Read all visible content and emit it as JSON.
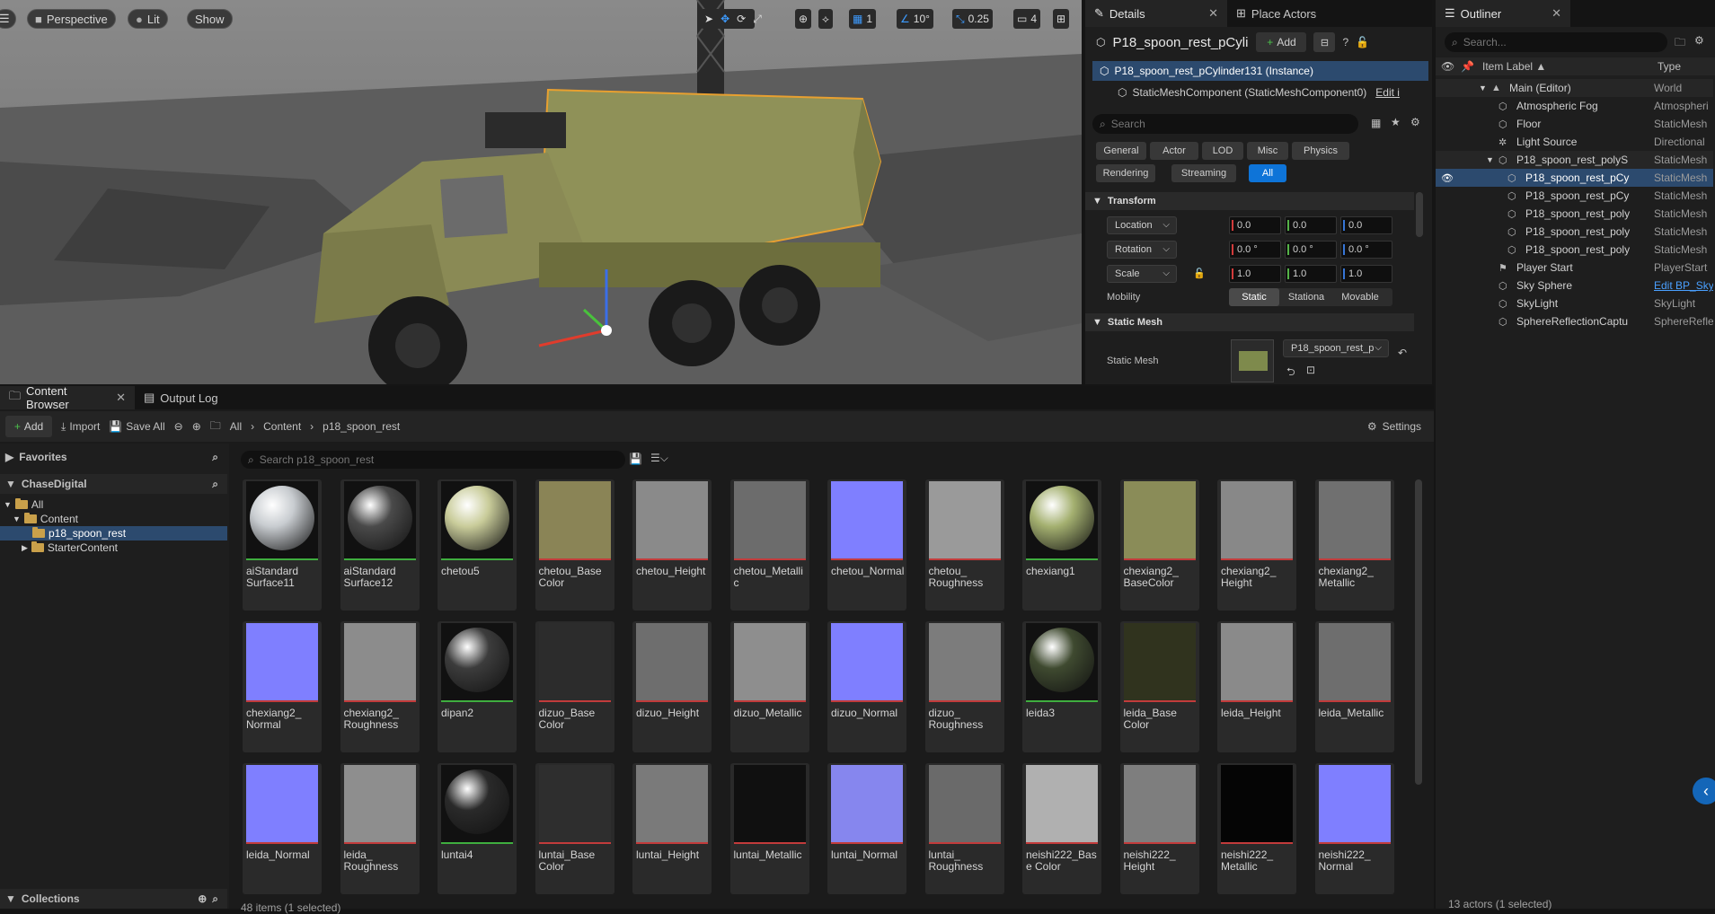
{
  "viewport": {
    "perspective": "Perspective",
    "lit": "Lit",
    "show": "Show",
    "grid_snap": "1",
    "rotate_snap": "10°",
    "scale_snap": "0.25",
    "camera_speed": "4"
  },
  "details": {
    "tab_label": "Details",
    "place_actors_tab": "Place Actors",
    "object_name": "P18_spoon_rest_pCylinde",
    "add_label": "Add",
    "instance_row": "P18_spoon_rest_pCylinder131 (Instance)",
    "component_row": "StaticMeshComponent (StaticMeshComponent0)",
    "edit_link": "Edit i",
    "search_placeholder": "Search",
    "filters": [
      "General",
      "Actor",
      "LOD",
      "Misc",
      "Physics",
      "Rendering",
      "Streaming",
      "All"
    ],
    "transform_header": "Transform",
    "location_label": "Location",
    "rotation_label": "Rotation",
    "scale_label": "Scale",
    "location": [
      "0.0",
      "0.0",
      "0.0"
    ],
    "rotation": [
      "0.0 °",
      "0.0 °",
      "0.0 °"
    ],
    "scale": [
      "1.0",
      "1.0",
      "1.0"
    ],
    "mobility_label": "Mobility",
    "mobility_options": [
      "Static",
      "Stationa",
      "Movable"
    ],
    "static_mesh_header": "Static Mesh",
    "static_mesh_label": "Static Mesh",
    "static_mesh_value": "P18_spoon_rest_p"
  },
  "outliner": {
    "tab_label": "Outliner",
    "search_placeholder": "Search...",
    "col_label": "Item Label ▲",
    "col_type": "Type",
    "rows": [
      {
        "label": "Main (Editor)",
        "type": "World"
      },
      {
        "label": "Atmospheric Fog",
        "type": "Atmospheri"
      },
      {
        "label": "Floor",
        "type": "StaticMesh"
      },
      {
        "label": "Light Source",
        "type": "Directional"
      },
      {
        "label": "P18_spoon_rest_polyS",
        "type": "StaticMesh"
      },
      {
        "label": "P18_spoon_rest_pCy",
        "type": "StaticMesh"
      },
      {
        "label": "P18_spoon_rest_pCy",
        "type": "StaticMesh"
      },
      {
        "label": "P18_spoon_rest_poly",
        "type": "StaticMesh"
      },
      {
        "label": "P18_spoon_rest_poly",
        "type": "StaticMesh"
      },
      {
        "label": "P18_spoon_rest_poly",
        "type": "StaticMesh"
      },
      {
        "label": "Player Start",
        "type": "PlayerStart"
      },
      {
        "label": "Sky Sphere",
        "type": "Edit BP_Sky"
      },
      {
        "label": "SkyLight",
        "type": "SkyLight"
      },
      {
        "label": "SphereReflectionCaptu",
        "type": "SphereRefle"
      }
    ],
    "footer": "13 actors (1 selected)"
  },
  "content_browser": {
    "tab_label": "Content Browser",
    "output_log_tab": "Output Log",
    "add_label": "Add",
    "import_label": "Import",
    "save_all_label": "Save All",
    "breadcrumb": [
      "All",
      "Content",
      "p18_spoon_rest"
    ],
    "settings_label": "Settings",
    "favorites_label": "Favorites",
    "project_label": "ChaseDigital",
    "tree": [
      "All",
      "Content",
      "p18_spoon_rest",
      "StarterContent"
    ],
    "search_placeholder": "Search p18_spoon_rest",
    "collections_label": "Collections",
    "status": "48 items (1 selected)",
    "assets": [
      {
        "name": "aiStandard Surface11",
        "kind": "mat",
        "color": "#c8ccd0"
      },
      {
        "name": "aiStandard Surface12",
        "kind": "mat",
        "color": "#4a4a4a"
      },
      {
        "name": "chetou5",
        "kind": "mat",
        "color": "#c9cc9a"
      },
      {
        "name": "chetou_Base Color",
        "kind": "tex",
        "color": "#8a8456"
      },
      {
        "name": "chetou_Height",
        "kind": "tex",
        "color": "#8a8a8a"
      },
      {
        "name": "chetou_Metallic",
        "kind": "tex",
        "color": "#6c6c6c"
      },
      {
        "name": "chetou_Normal",
        "kind": "tex",
        "color": "#7f7fff"
      },
      {
        "name": "chetou_ Roughness",
        "kind": "tex",
        "color": "#9a9a9a"
      },
      {
        "name": "chexiang1",
        "kind": "mat",
        "color": "#a4b070"
      },
      {
        "name": "chexiang2_ BaseColor",
        "kind": "tex",
        "color": "#8a8c58"
      },
      {
        "name": "chexiang2_ Height",
        "kind": "tex",
        "color": "#888888"
      },
      {
        "name": "chexiang2_ Metallic",
        "kind": "tex",
        "color": "#707070"
      },
      {
        "name": "chexiang2_ Normal",
        "kind": "tex",
        "color": "#7f7fff"
      },
      {
        "name": "chexiang2_ Roughness",
        "kind": "tex",
        "color": "#8c8c8c"
      },
      {
        "name": "dipan2",
        "kind": "mat",
        "color": "#3c3c3c"
      },
      {
        "name": "dizuo_Base Color",
        "kind": "tex",
        "color": "#2c2c2c"
      },
      {
        "name": "dizuo_Height",
        "kind": "tex",
        "color": "#6e6e6e"
      },
      {
        "name": "dizuo_Metallic",
        "kind": "tex",
        "color": "#8e8e8e"
      },
      {
        "name": "dizuo_Normal",
        "kind": "tex",
        "color": "#7f7fff"
      },
      {
        "name": "dizuo_ Roughness",
        "kind": "tex",
        "color": "#7c7c7c"
      },
      {
        "name": "leida3",
        "kind": "mat",
        "color": "#3f4a30"
      },
      {
        "name": "leida_Base Color",
        "kind": "tex",
        "color": "#30331e"
      },
      {
        "name": "leida_Height",
        "kind": "tex",
        "color": "#8a8a8a"
      },
      {
        "name": "leida_Metallic",
        "kind": "tex",
        "color": "#6e6e6e"
      },
      {
        "name": "leida_Normal",
        "kind": "tex",
        "color": "#7f7fff"
      },
      {
        "name": "leida_ Roughness",
        "kind": "tex",
        "color": "#8e8e8e"
      },
      {
        "name": "luntai4",
        "kind": "mat",
        "color": "#2a2a2a"
      },
      {
        "name": "luntai_Base Color",
        "kind": "tex",
        "color": "#2e2e2e"
      },
      {
        "name": "luntai_Height",
        "kind": "tex",
        "color": "#7a7a7a"
      },
      {
        "name": "luntai_Metallic",
        "kind": "tex",
        "color": "#101010"
      },
      {
        "name": "luntai_Normal",
        "kind": "tex",
        "color": "#8686ee"
      },
      {
        "name": "luntai_ Roughness",
        "kind": "tex",
        "color": "#6a6a6a"
      },
      {
        "name": "neishi222_Base Color",
        "kind": "tex",
        "color": "#b0b0b0"
      },
      {
        "name": "neishi222_ Height",
        "kind": "tex",
        "color": "#7e7e7e"
      },
      {
        "name": "neishi222_ Metallic",
        "kind": "tex",
        "color": "#050505"
      },
      {
        "name": "neishi222_ Normal",
        "kind": "tex",
        "color": "#7f7fff"
      }
    ]
  },
  "colors": {
    "accent": "#0e74d8",
    "selected_row": "#2c4a6e",
    "material_bar": "#3fae3f",
    "texture_bar": "#c23b3b"
  }
}
